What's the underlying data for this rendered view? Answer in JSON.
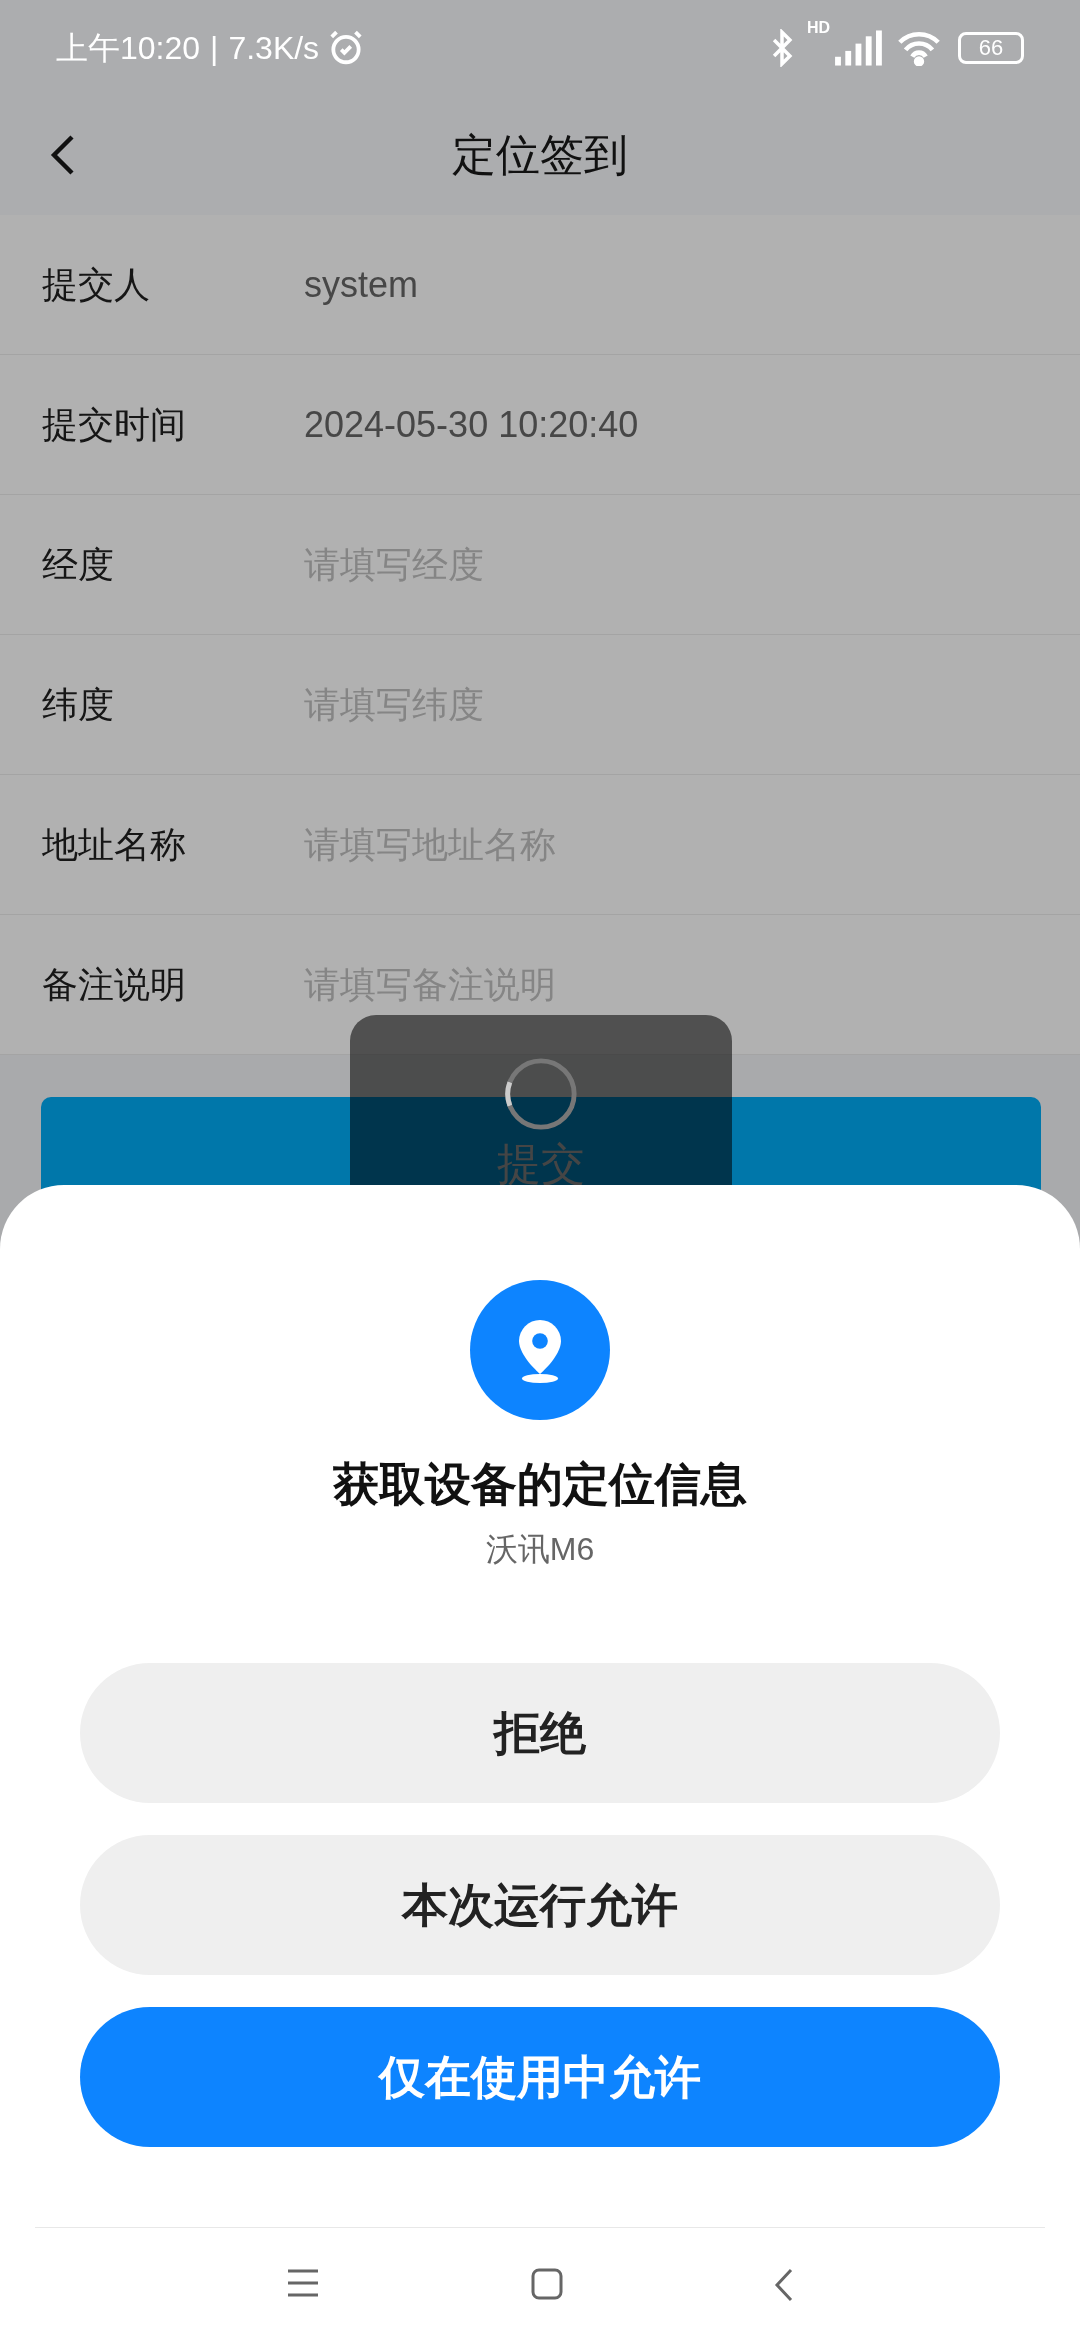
{
  "status_bar": {
    "time": "上午10:20",
    "separator": "|",
    "speed": "7.3K/s",
    "network_label": "HD",
    "battery": "66"
  },
  "header": {
    "title": "定位签到"
  },
  "fields": [
    {
      "label": "提交人",
      "value": "system"
    },
    {
      "label": "提交时间",
      "value": "2024-05-30 10:20:40"
    },
    {
      "label": "经度",
      "placeholder": "请填写经度"
    },
    {
      "label": "纬度",
      "placeholder": "请填写纬度"
    },
    {
      "label": "地址名称",
      "placeholder": "请填写地址名称"
    },
    {
      "label": "备注说明",
      "placeholder": "请填写备注说明"
    }
  ],
  "submit_button": "提交",
  "permission_dialog": {
    "title": "获取设备的定位信息",
    "app": "沃讯M6",
    "buttons": [
      {
        "label": "拒绝",
        "kind": "secondary"
      },
      {
        "label": "本次运行允许",
        "kind": "secondary"
      },
      {
        "label": "仅在使用中允许",
        "kind": "primary"
      }
    ]
  }
}
